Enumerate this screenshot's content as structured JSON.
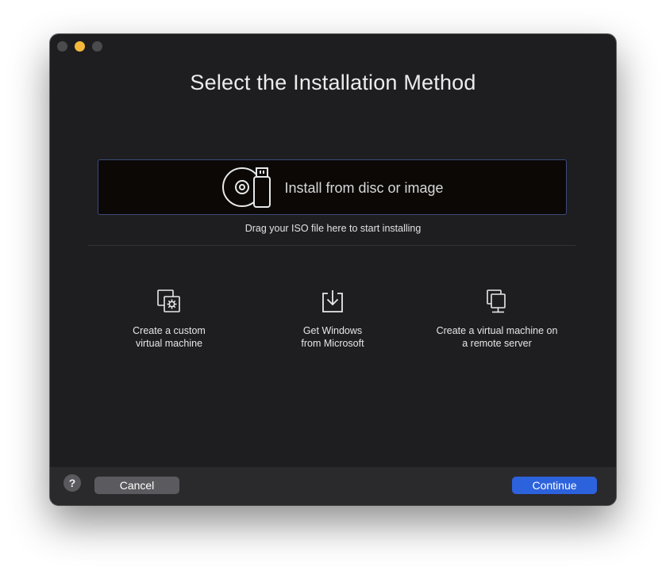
{
  "window": {
    "title": "Select the Installation Method",
    "traffic_lights": [
      "close",
      "minimize",
      "zoom"
    ]
  },
  "dropzone": {
    "label": "Install from disc or image",
    "icon": "disc-usb-icon",
    "hint": "Drag your ISO file here to start installing"
  },
  "options": [
    {
      "label": "Create a custom\nvirtual machine",
      "icon": "custom-vm-icon"
    },
    {
      "label": "Get Windows\nfrom Microsoft",
      "icon": "download-icon"
    },
    {
      "label": "Create a virtual machine on\na remote server",
      "icon": "remote-server-icon"
    }
  ],
  "footer": {
    "help_label": "?",
    "cancel_label": "Cancel",
    "continue_label": "Continue"
  },
  "colors": {
    "window_bg": "#1e1e20",
    "dropzone_border": "#3b4a7a",
    "accent": "#2d62dd",
    "minimize": "#f4b93b"
  }
}
